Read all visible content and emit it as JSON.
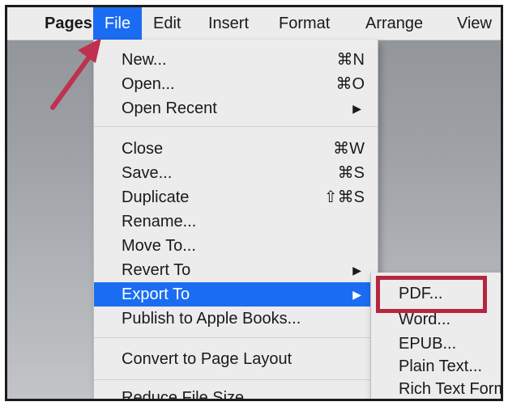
{
  "menubar": {
    "items": [
      "Pages",
      "File",
      "Edit",
      "Insert",
      "Format",
      "Arrange",
      "View"
    ]
  },
  "file_menu": {
    "group1": [
      {
        "label": "New...",
        "shortcut": "⌘N"
      },
      {
        "label": "Open...",
        "shortcut": "⌘O"
      },
      {
        "label": "Open Recent",
        "submenu": "▶"
      }
    ],
    "group2": [
      {
        "label": "Close",
        "shortcut": "⌘W"
      },
      {
        "label": "Save...",
        "shortcut": "⌘S"
      },
      {
        "label": "Duplicate",
        "shortcut": "⇧⌘S"
      },
      {
        "label": "Rename..."
      },
      {
        "label": "Move To..."
      },
      {
        "label": "Revert To",
        "submenu": "▶"
      },
      {
        "label": "Export To",
        "submenu": "▶"
      },
      {
        "label": "Publish to Apple Books..."
      }
    ],
    "group3": [
      {
        "label": "Convert to Page Layout"
      }
    ],
    "group4": [
      {
        "label": "Reduce File Size..."
      }
    ]
  },
  "export_submenu": {
    "items": [
      "PDF...",
      "Word...",
      "EPUB...",
      "Plain Text...",
      "Rich Text Format..."
    ]
  },
  "colors": {
    "highlight": "#1a6df2",
    "callout": "#b5263f",
    "arrow": "#c0304f"
  }
}
